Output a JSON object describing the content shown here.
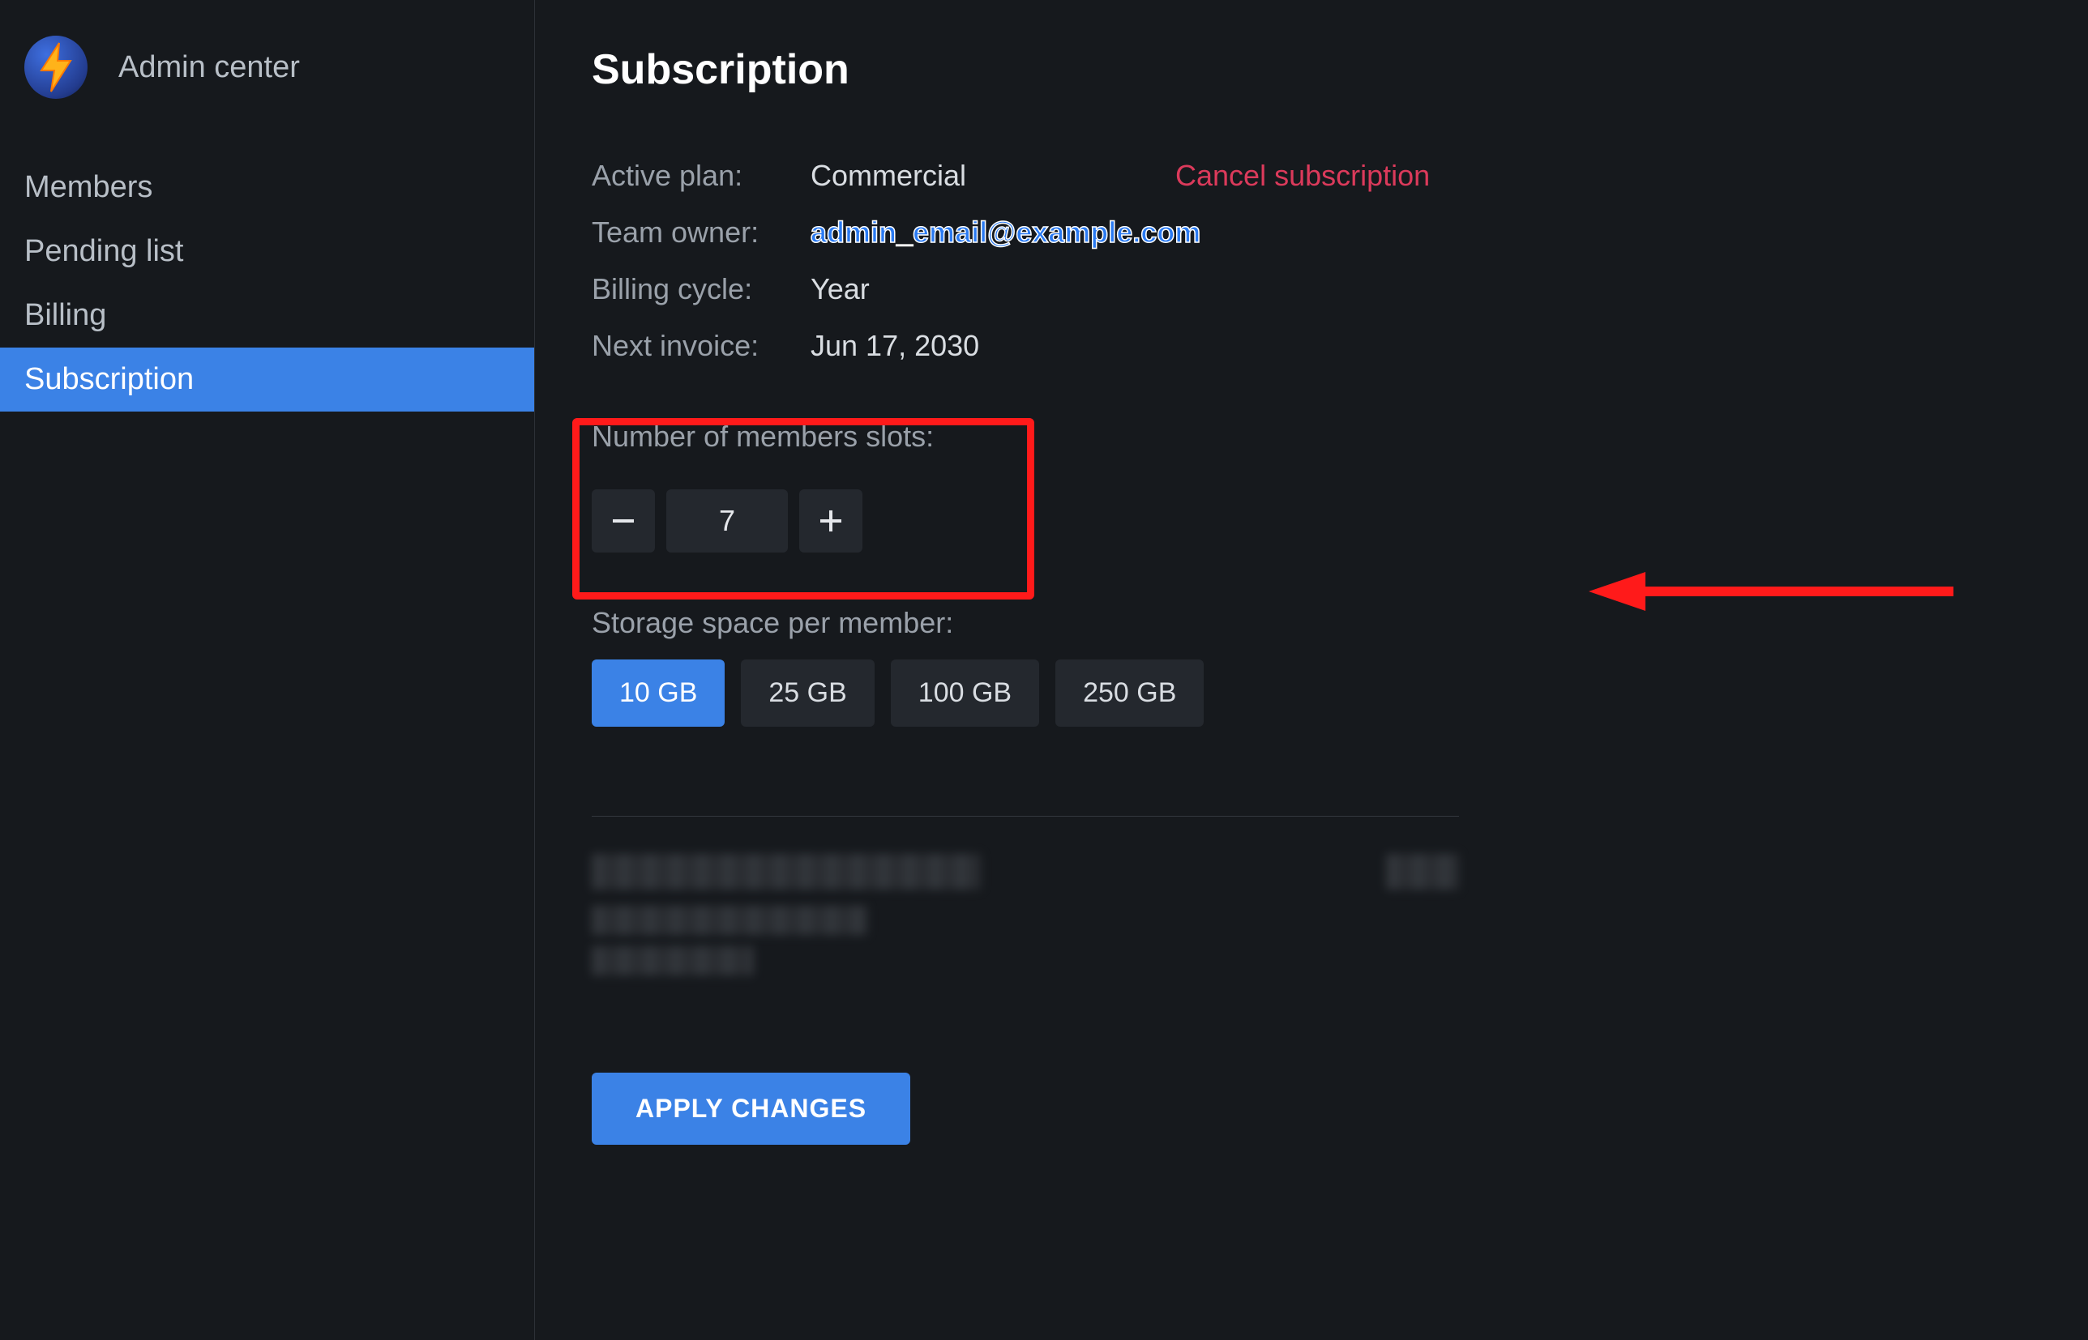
{
  "brand": {
    "title": "Admin center"
  },
  "sidebar": {
    "items": [
      {
        "label": "Members",
        "active": false
      },
      {
        "label": "Pending list",
        "active": false
      },
      {
        "label": "Billing",
        "active": false
      },
      {
        "label": "Subscription",
        "active": true
      }
    ]
  },
  "page": {
    "title": "Subscription",
    "info": {
      "active_plan_label": "Active plan:",
      "active_plan_value": "Commercial",
      "team_owner_label": "Team owner:",
      "team_owner_value": "admin_email@example.com",
      "billing_cycle_label": "Billing cycle:",
      "billing_cycle_value": "Year",
      "next_invoice_label": "Next invoice:",
      "next_invoice_value": "Jun 17, 2030"
    },
    "cancel_link": "Cancel subscription",
    "members_slots": {
      "label": "Number of members slots:",
      "value": "7"
    },
    "storage": {
      "label": "Storage space per member:",
      "options": [
        "10 GB",
        "25 GB",
        "100 GB",
        "250 GB"
      ],
      "selected_index": 0
    },
    "apply_button": "APPLY CHANGES"
  },
  "colors": {
    "accent": "#3b82e6",
    "danger": "#db3a5b",
    "annotation": "#ff1a1a"
  }
}
